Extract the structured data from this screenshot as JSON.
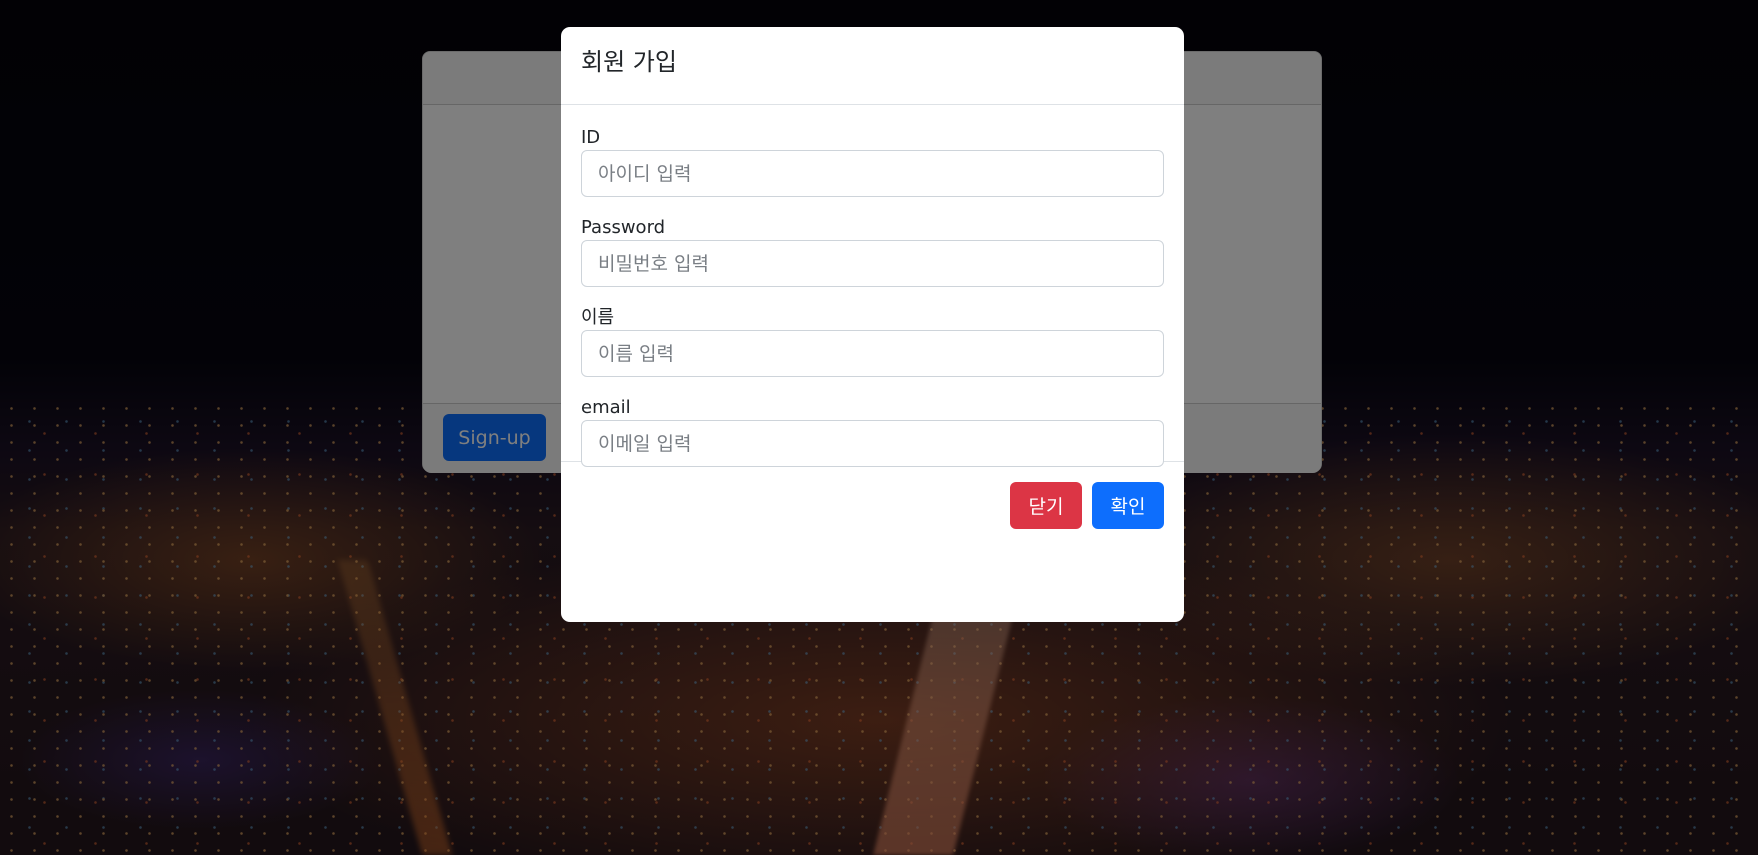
{
  "background": {
    "label": "night city background"
  },
  "back_card": {
    "signup_label": "Sign-up"
  },
  "modal": {
    "title": "회원 가입",
    "fields": [
      {
        "label": "ID",
        "placeholder": "아이디 입력",
        "value": ""
      },
      {
        "label": "Password",
        "placeholder": "비밀번호 입력",
        "value": ""
      },
      {
        "label": "이름",
        "placeholder": "이름 입력",
        "value": ""
      },
      {
        "label": "email",
        "placeholder": "이메일 입력",
        "value": ""
      }
    ],
    "close_label": "닫기",
    "confirm_label": "확인"
  },
  "colors": {
    "primary": "#0d6efd",
    "danger": "#dc3545"
  }
}
